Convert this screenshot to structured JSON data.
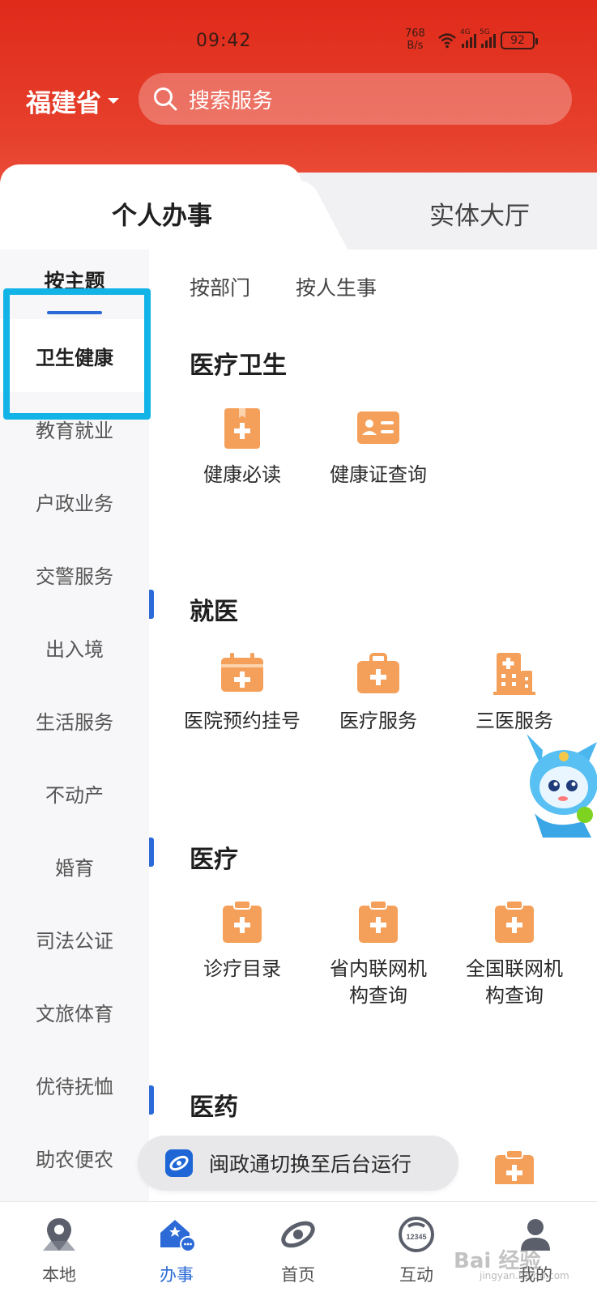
{
  "status_bar": {
    "time": "09:42",
    "net_speed_value": "768",
    "net_speed_unit": "B/s",
    "network_4g": "4G",
    "network_5g": "5G",
    "battery": "92"
  },
  "header": {
    "province": "福建省",
    "search_placeholder": "搜索服务"
  },
  "top_tabs": {
    "active": "个人办事",
    "inactive": "实体大厅"
  },
  "sidebar": {
    "theme_label": "按主题",
    "items": [
      {
        "label": "卫生健康",
        "active": true
      },
      {
        "label": "教育就业"
      },
      {
        "label": "户政业务"
      },
      {
        "label": "交警服务"
      },
      {
        "label": "出入境"
      },
      {
        "label": "生活服务"
      },
      {
        "label": "不动产"
      },
      {
        "label": "婚育"
      },
      {
        "label": "司法公证"
      },
      {
        "label": "文旅体育"
      },
      {
        "label": "优待抚恤"
      },
      {
        "label": "助农便农"
      }
    ]
  },
  "sub_tabs": [
    "按部门",
    "按人生事"
  ],
  "sections": [
    {
      "title": "医疗卫生",
      "services": [
        {
          "label": "健康必读",
          "icon": "book-plus-icon"
        },
        {
          "label": "健康证查询",
          "icon": "id-card-icon"
        }
      ]
    },
    {
      "title": "就医",
      "services": [
        {
          "label": "医院预约挂号",
          "icon": "calendar-plus-icon"
        },
        {
          "label": "医疗服务",
          "icon": "medical-kit-icon"
        },
        {
          "label": "三医服务",
          "icon": "hospital-building-icon"
        }
      ]
    },
    {
      "title": "医疗",
      "services": [
        {
          "label": "诊疗目录",
          "icon": "clipboard-plus-icon"
        },
        {
          "label": "省内联网机构查询",
          "icon": "clipboard-plus-icon"
        },
        {
          "label": "全国联网机构查询",
          "icon": "clipboard-plus-icon"
        }
      ]
    },
    {
      "title": "医药",
      "services": []
    }
  ],
  "toast": {
    "text": "闽政通切换至后台运行"
  },
  "bottom_nav": [
    {
      "label": "本地",
      "icon": "location-icon"
    },
    {
      "label": "办事",
      "icon": "service-house-icon",
      "active": true
    },
    {
      "label": "首页",
      "icon": "home-logo-icon"
    },
    {
      "label": "互动",
      "icon": "hotline-12345-icon"
    },
    {
      "label": "我的",
      "icon": "profile-icon"
    }
  ],
  "watermark": {
    "text": "Bai 经验",
    "sub": "jingyan.baidu.com"
  },
  "colors": {
    "brand_red": "#e02a1a",
    "accent_blue": "#2c6bd7",
    "icon_orange": "#f5a05a",
    "highlight_cyan": "#12b3e6"
  }
}
